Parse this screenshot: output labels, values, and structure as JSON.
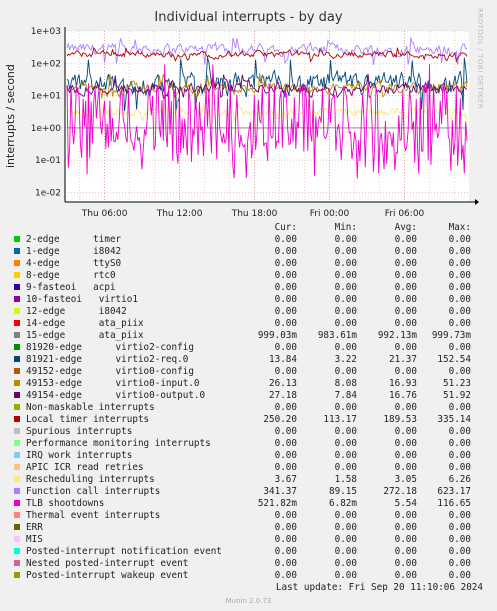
{
  "title": "Individual interrupts - by day",
  "side_label": "RRDTOOL / TOBI OETIKER",
  "columns": [
    "Cur:",
    "Min:",
    "Avg:",
    "Max:"
  ],
  "rows": [
    {
      "name": "2-edge      timer",
      "color": "#00cc00",
      "cur": "0.00",
      "min": "0.00",
      "avg": "0.00",
      "max": "0.00"
    },
    {
      "name": "1-edge      i8042",
      "color": "#0066b3",
      "cur": "0.00",
      "min": "0.00",
      "avg": "0.00",
      "max": "0.00"
    },
    {
      "name": "4-edge      ttyS0",
      "color": "#ff8000",
      "cur": "0.00",
      "min": "0.00",
      "avg": "0.00",
      "max": "0.00"
    },
    {
      "name": "8-edge      rtc0",
      "color": "#ffcc00",
      "cur": "0.00",
      "min": "0.00",
      "avg": "0.00",
      "max": "0.00"
    },
    {
      "name": "9-fasteoi   acpi",
      "color": "#330099",
      "cur": "0.00",
      "min": "0.00",
      "avg": "0.00",
      "max": "0.00"
    },
    {
      "name": "10-fasteoi   virtio1",
      "color": "#990099",
      "cur": "0.00",
      "min": "0.00",
      "avg": "0.00",
      "max": "0.00"
    },
    {
      "name": "12-edge      i8042",
      "color": "#ccff00",
      "cur": "0.00",
      "min": "0.00",
      "avg": "0.00",
      "max": "0.00"
    },
    {
      "name": "14-edge      ata_piix",
      "color": "#ff0000",
      "cur": "0.00",
      "min": "0.00",
      "avg": "0.00",
      "max": "0.00"
    },
    {
      "name": "15-edge      ata_piix",
      "color": "#808080",
      "cur": "999.03m",
      "min": "983.61m",
      "avg": "992.13m",
      "max": "999.73m"
    },
    {
      "name": "81920-edge      virtio2-config",
      "color": "#008f00",
      "cur": "0.00",
      "min": "0.00",
      "avg": "0.00",
      "max": "0.00"
    },
    {
      "name": "81921-edge      virtio2-req.0",
      "color": "#00487d",
      "cur": "13.84",
      "min": "3.22",
      "avg": "21.37",
      "max": "152.54"
    },
    {
      "name": "49152-edge      virtio0-config",
      "color": "#b35a00",
      "cur": "0.00",
      "min": "0.00",
      "avg": "0.00",
      "max": "0.00"
    },
    {
      "name": "49153-edge      virtio0-input.0",
      "color": "#b38f00",
      "cur": "26.13",
      "min": "8.08",
      "avg": "16.93",
      "max": "51.23"
    },
    {
      "name": "49154-edge      virtio0-output.0",
      "color": "#6b006b",
      "cur": "27.18",
      "min": "7.84",
      "avg": "16.76",
      "max": "51.92"
    },
    {
      "name": "Non-maskable interrupts",
      "color": "#8fb300",
      "cur": "0.00",
      "min": "0.00",
      "avg": "0.00",
      "max": "0.00"
    },
    {
      "name": "Local timer interrupts",
      "color": "#b30000",
      "cur": "250.20",
      "min": "113.17",
      "avg": "189.53",
      "max": "335.14"
    },
    {
      "name": "Spurious interrupts",
      "color": "#bebebe",
      "cur": "0.00",
      "min": "0.00",
      "avg": "0.00",
      "max": "0.00"
    },
    {
      "name": "Performance monitoring interrupts",
      "color": "#80ff80",
      "cur": "0.00",
      "min": "0.00",
      "avg": "0.00",
      "max": "0.00"
    },
    {
      "name": "IRQ work interrupts",
      "color": "#80c9ff",
      "cur": "0.00",
      "min": "0.00",
      "avg": "0.00",
      "max": "0.00"
    },
    {
      "name": "APIC ICR read retries",
      "color": "#ffc080",
      "cur": "0.00",
      "min": "0.00",
      "avg": "0.00",
      "max": "0.00"
    },
    {
      "name": "Rescheduling interrupts",
      "color": "#ffe680",
      "cur": "3.67",
      "min": "1.58",
      "avg": "3.05",
      "max": "6.26"
    },
    {
      "name": "Function call interrupts",
      "color": "#aa80ff",
      "cur": "341.37",
      "min": "89.15",
      "avg": "272.18",
      "max": "623.17"
    },
    {
      "name": "TLB shootdowns",
      "color": "#ee00cc",
      "cur": "521.82m",
      "min": "6.82m",
      "avg": "5.54",
      "max": "116.65"
    },
    {
      "name": "Thermal event interrupts",
      "color": "#ff8080",
      "cur": "0.00",
      "min": "0.00",
      "avg": "0.00",
      "max": "0.00"
    },
    {
      "name": "ERR",
      "color": "#666600",
      "cur": "0.00",
      "min": "0.00",
      "avg": "0.00",
      "max": "0.00"
    },
    {
      "name": "MIS",
      "color": "#ffbfff",
      "cur": "0.00",
      "min": "0.00",
      "avg": "0.00",
      "max": "0.00"
    },
    {
      "name": "Posted-interrupt notification event",
      "color": "#00ffcc",
      "cur": "0.00",
      "min": "0.00",
      "avg": "0.00",
      "max": "0.00"
    },
    {
      "name": "Nested posted-interrupt event",
      "color": "#cc6699",
      "cur": "0.00",
      "min": "0.00",
      "avg": "0.00",
      "max": "0.00"
    },
    {
      "name": "Posted-interrupt wakeup event",
      "color": "#999900",
      "cur": "0.00",
      "min": "0.00",
      "avg": "0.00",
      "max": "0.00"
    }
  ],
  "last_update": "Last update: Fri Sep 20 11:10:06 2024",
  "version": "Munin 2.0.73",
  "chart_data": {
    "type": "line",
    "title": "Individual interrupts - by day",
    "ylabel": "interrupts / second",
    "yscale": "log",
    "ylim": [
      0.005,
      1000
    ],
    "yticks": [
      {
        "v": 1000,
        "label": "1e+03"
      },
      {
        "v": 100,
        "label": "1e+02"
      },
      {
        "v": 10,
        "label": "1e+01"
      },
      {
        "v": 1,
        "label": "1e+00"
      },
      {
        "v": 0.1,
        "label": "1e-01"
      },
      {
        "v": 0.01,
        "label": "1e-02"
      }
    ],
    "xrange": [
      "Thu 02:50",
      "Fri 11:10"
    ],
    "xticks": [
      {
        "label": "Thu 06:00",
        "hours": 3.17
      },
      {
        "label": "Thu 12:00",
        "hours": 9.17
      },
      {
        "label": "Thu 18:00",
        "hours": 15.17
      },
      {
        "label": "Fri 00:00",
        "hours": 21.17
      },
      {
        "label": "Fri 06:00",
        "hours": 27.17
      }
    ],
    "x_hours_total": 32.33,
    "grid": true,
    "series": [
      {
        "name": "Function call interrupts",
        "color": "#aa80ff",
        "min": 89.15,
        "avg": 272.18,
        "max": 623.17,
        "cur": 341.37
      },
      {
        "name": "Local timer interrupts",
        "color": "#b30000",
        "min": 113.17,
        "avg": 189.53,
        "max": 335.14,
        "cur": 250.2
      },
      {
        "name": "81921-edge      virtio2-req.0",
        "color": "#00487d",
        "min": 3.22,
        "avg": 21.37,
        "max": 152.54,
        "cur": 13.84
      },
      {
        "name": "49153-edge      virtio0-input.0",
        "color": "#b38f00",
        "min": 8.08,
        "avg": 16.93,
        "max": 51.23,
        "cur": 26.13
      },
      {
        "name": "49154-edge      virtio0-output.0",
        "color": "#6b006b",
        "min": 7.84,
        "avg": 16.76,
        "max": 51.92,
        "cur": 27.18
      },
      {
        "name": "Rescheduling interrupts",
        "color": "#ffe680",
        "min": 1.58,
        "avg": 3.05,
        "max": 6.26,
        "cur": 3.67
      },
      {
        "name": "15-edge      ata_piix",
        "color": "#808080",
        "min": 0.98361,
        "avg": 0.99213,
        "max": 0.99973,
        "cur": 0.99903
      },
      {
        "name": "TLB shootdowns",
        "color": "#ee00cc",
        "min": 0.00682,
        "avg": 5.54,
        "max": 116.65,
        "cur": 0.52182
      }
    ]
  }
}
